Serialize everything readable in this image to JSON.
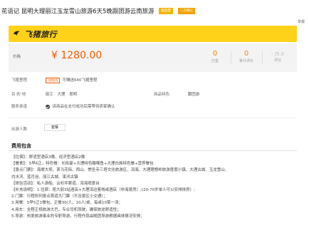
{
  "title": "花语记 昆明大理丽江玉龙雪山旅游6天5晚跟团游云南旅游",
  "tags": [
    "跟团游",
    "二次确认"
  ],
  "report_label": "举报",
  "brand": {
    "logo_text": "飞猪旅行",
    "logo_color": "#222222",
    "bg_color": "#ffd21a"
  },
  "price": {
    "label": "价格",
    "value": "¥ 1280.00",
    "stats": [
      {
        "num": "0",
        "label": "已售"
      },
      {
        "num": "0",
        "label": "累计评价"
      },
      {
        "num": "- /5.0",
        "label": "评分"
      }
    ]
  },
  "points": {
    "label": "飞猪里程",
    "badge": "飞猪里程",
    "text": "可赚送640飞猪里程"
  },
  "destination": {
    "label": "目 的 地",
    "values": [
      "丽江",
      "大理",
      "昆明"
    ]
  },
  "product_feature": {
    "label": "商品特色",
    "value": "跟团游"
  },
  "service": {
    "label": "服务承诺",
    "value": "该商品在支付成功后需等待卖家确认"
  },
  "quantity": {
    "label": "出游人数",
    "value": "套餐"
  },
  "section": {
    "title": "费用包含"
  },
  "content_lines": [
    "【住宿】：舒适型酒店3晚、经济型酒店2晚",
    "【餐食】：5早6正，特色餐：长街宴+大理特色酸辣鱼+大理白族特色餐+营养餐包",
    "【景点门票】：海埂大坝、茶马花街、西山、崇圣寺三塔文化旅游区、洱海、大理理想邦旅游度假小镇、大理古城、玉龙雪山、",
    "白水河、蓝月谷、丽江古城、束河古镇",
    "【体验活动】：私人游船、云杉坪索道、洱海观景台",
    "【补充说明】：1.住宿：昆大丽3站酒店+大理洱边客栈或酒店（非海景房）;(20-70岁单人可以安排拼房）;",
    "2.门票：行程所列景点首道大门票（不含景区小交通）；",
    "3.用餐：5早5正1餐包，正餐30/人，10人/桌，每桌10菜一汤；",
    "4.用车：全程正规旅游大巴，专业司机驾驶，确保旅途舒适性；",
    "5.导游：热爱旅游事业的专职导游，行程作息由随团导游根据具体情况安排；"
  ],
  "colors": {
    "accent": "#f45a00",
    "stat": "#f08a00"
  }
}
